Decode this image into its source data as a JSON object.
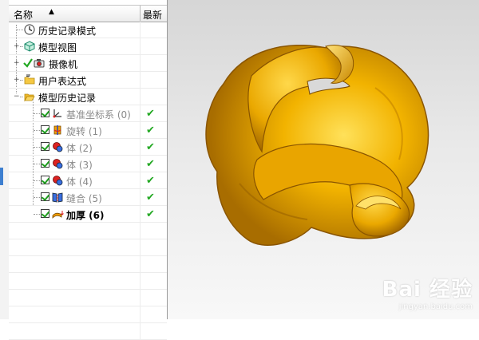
{
  "navigator": {
    "col_name": "名称",
    "col_latest": "最新",
    "sort_glyph": "▲",
    "latest_mark": "✔",
    "nodes": [
      {
        "label": "历史记录模式"
      },
      {
        "label": "模型视图"
      },
      {
        "label": "摄像机"
      },
      {
        "label": "用户表达式"
      },
      {
        "label": "模型历史记录"
      }
    ],
    "features": [
      {
        "label": "基准坐标系 (0)"
      },
      {
        "label": "旋转 (1)"
      },
      {
        "label": "体 (2)"
      },
      {
        "label": "体 (3)"
      },
      {
        "label": "体 (4)"
      },
      {
        "label": "缝合 (5)"
      },
      {
        "label": "加厚 (6)"
      }
    ]
  },
  "watermark": {
    "brand": "Bai 经验",
    "url": "jingyan.baidu.com"
  },
  "colors": {
    "model": "#f2b300",
    "model_dark": "#b87800",
    "check_green": "#22a822"
  }
}
